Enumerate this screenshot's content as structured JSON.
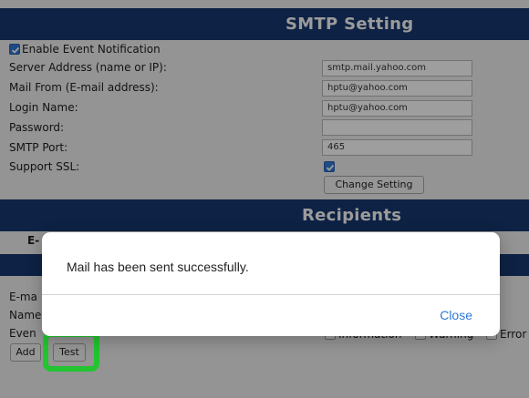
{
  "smtp": {
    "title": "SMTP Setting",
    "enable_notification_label": "Enable Event Notification",
    "enable_notification_checked": true,
    "server_address_label": "Server Address (name or IP):",
    "server_address_value": "smtp.mail.yahoo.com",
    "mail_from_label": "Mail From (E-mail address):",
    "mail_from_value": "hptu@yahoo.com",
    "login_name_label": "Login Name:",
    "login_name_value": "hptu@yahoo.com",
    "password_label": "Password:",
    "password_value": "",
    "smtp_port_label": "SMTP Port:",
    "smtp_port_value": "465",
    "support_ssl_label": "Support SSL:",
    "support_ssl_checked": true,
    "change_setting_label": "Change Setting"
  },
  "recipients": {
    "title": "Recipients",
    "column_email_partial": "E-",
    "email_label_partial": "E-ma",
    "name_label_partial": "Name",
    "event_label_partial": "Even",
    "event_types": [
      "Information",
      "Warning",
      "Error"
    ],
    "add_label": "Add",
    "test_label": "Test"
  },
  "dialog": {
    "message": "Mail has been sent successfully.",
    "close_label": "Close"
  },
  "colors": {
    "header_bg": "#15386e",
    "highlight": "#22c431",
    "link_blue": "#2e78d6",
    "checkbox_blue": "#3478d4"
  }
}
